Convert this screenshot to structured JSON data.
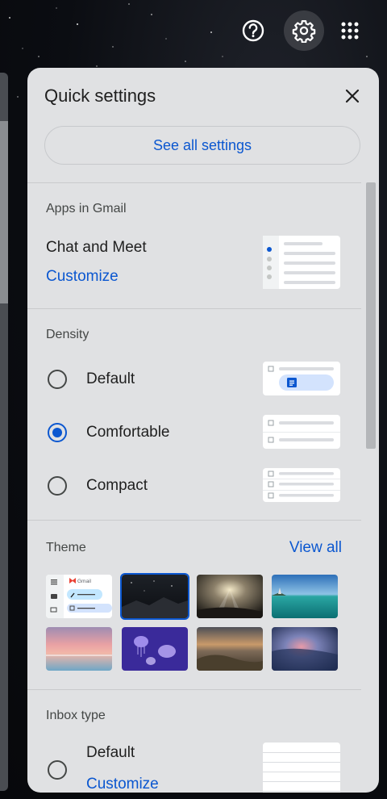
{
  "topbar": {
    "help_icon": "help-circle-icon",
    "settings_icon": "gear-icon",
    "apps_icon": "apps-grid-icon"
  },
  "panel": {
    "title": "Quick settings",
    "close_icon": "close-icon",
    "see_all_label": "See all settings"
  },
  "apps_section": {
    "heading": "Apps in Gmail",
    "item_title": "Chat and Meet",
    "customize_label": "Customize"
  },
  "density": {
    "heading": "Density",
    "options": [
      {
        "label": "Default",
        "selected": false
      },
      {
        "label": "Comfortable",
        "selected": true
      },
      {
        "label": "Compact",
        "selected": false
      }
    ]
  },
  "theme": {
    "heading": "Theme",
    "view_all_label": "View all",
    "gmail_thumb_label": "Gmail",
    "thumbnails": [
      {
        "name": "default-light"
      },
      {
        "name": "starry-night",
        "selected": true
      },
      {
        "name": "sun-rays"
      },
      {
        "name": "tropical-lake"
      },
      {
        "name": "pink-sunset"
      },
      {
        "name": "jellyfish"
      },
      {
        "name": "rocky-shore"
      },
      {
        "name": "storm-clouds"
      }
    ]
  },
  "inbox_type": {
    "heading": "Inbox type",
    "option_label": "Default",
    "customize_label": "Customize"
  },
  "colors": {
    "accent": "#0b57d0",
    "panel_bg": "#e0e1e3"
  }
}
